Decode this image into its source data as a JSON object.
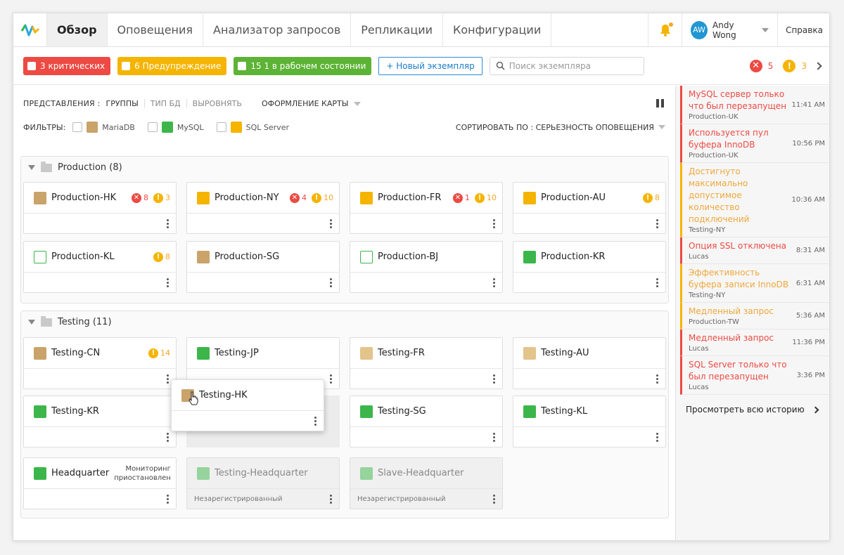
{
  "nav": {
    "tabs": [
      {
        "label": "Обзор",
        "active": true
      },
      {
        "label": "Оповещения"
      },
      {
        "label": "Анализатор запросов"
      },
      {
        "label": "Репликации"
      },
      {
        "label": "Конфигурации"
      }
    ],
    "user": {
      "initials": "AW",
      "name": "Andy Wong"
    },
    "help": "Справка"
  },
  "toolbar": {
    "critical": "3 критических",
    "warning": "6 Предупреждение",
    "healthy": "15 1 в рабочем состоянии",
    "new_instance": "+ Новый экземпляр",
    "search_placeholder": "Поиск экземпляра",
    "err_count": "5",
    "warn_count": "3"
  },
  "view": {
    "label": "ПРЕДСТАВЛЕНИЯ :",
    "groups": "ГРУППЫ",
    "dbtype": "ТИП БД",
    "align": "ВЫРОВНЯТЬ",
    "theme": "ОФОРМЛЕНИЕ КАРТЫ",
    "filters_label": "ФИЛЬТРЫ:",
    "filters": [
      "MariaDB",
      "MySQL",
      "SQL Server"
    ],
    "sort": "СОРТИРОВАТЬ ПО : СЕРЬЕЗНОСТЬ ОПОВЕЩЕНИЯ"
  },
  "groups": [
    {
      "name": "Production (8)",
      "cards": [
        {
          "name": "Production-HK",
          "db": "maria",
          "err": "8",
          "warn": "3"
        },
        {
          "name": "Production-NY",
          "db": "sql",
          "err": "4",
          "warn": "10"
        },
        {
          "name": "Production-FR",
          "db": "sql",
          "err": "1",
          "warn": "10"
        },
        {
          "name": "Production-AU",
          "db": "sql",
          "warn": "8"
        },
        {
          "name": "Production-KL",
          "db": "cloud",
          "warn": "8"
        },
        {
          "name": "Production-SG",
          "db": "maria"
        },
        {
          "name": "Production-BJ",
          "db": "cloud"
        },
        {
          "name": "Production-KR",
          "db": "mysql"
        }
      ]
    },
    {
      "name": "Testing (11)",
      "cards": [
        {
          "name": "Testing-CN",
          "db": "maria",
          "warn": "14"
        },
        {
          "name": "Testing-JP",
          "db": "mysql"
        },
        {
          "name": "Testing-FR",
          "db": "box"
        },
        {
          "name": "Testing-AU",
          "db": "box"
        },
        {
          "name": "Testing-KR",
          "db": "mysql"
        },
        {
          "name": "Testing-HK",
          "db": "maria"
        },
        {
          "name": "Testing-SG",
          "db": "mysql"
        },
        {
          "name": "Testing-KL",
          "db": "mysql"
        },
        {
          "name": "Headquarter",
          "db": "mysql",
          "status": "Мониторинг приостановлен"
        },
        {
          "name": "Testing-Headquarter",
          "db": "mysql",
          "footer": "Незарегистрированный"
        },
        {
          "name": "Slave-Headquarter",
          "db": "mysql",
          "footer": "Незарегистрированный"
        }
      ]
    }
  ],
  "events": [
    {
      "title": "MySQL сервер только что был перезапущен",
      "source": "Production-UK",
      "time": "11:41 AM",
      "level": "critical"
    },
    {
      "title": "Используется пул буфера InnoDB",
      "source": "Production-UK",
      "time": "10:56 PM",
      "level": "critical"
    },
    {
      "title": "Достигнуто максимально допустимое количество подключений",
      "source": "Testing-NY",
      "time": "10:36 AM",
      "level": "warning"
    },
    {
      "title": "Опция SSL отключена",
      "source": "Lucas",
      "time": "8:31 AM",
      "level": "critical"
    },
    {
      "title": "Эффективность буфера записи InnoDB",
      "source": "Testing-NY",
      "time": "6:31 AM",
      "level": "warning"
    },
    {
      "title": "Медленный запрос",
      "source": "Production-TW",
      "time": "5:36 AM",
      "level": "warning"
    },
    {
      "title": "Медленный запрос",
      "source": "Lucas",
      "time": "11:36 PM",
      "level": "critical"
    },
    {
      "title": "SQL Server только что был перезапущен",
      "source": "Lucas",
      "time": "3:36 PM",
      "level": "critical"
    }
  ],
  "history": "Просмотреть всю историю",
  "colors": {
    "critical": "#ec4a43",
    "warning": "#f5b400",
    "healthy": "#5cb335",
    "accent": "#2b8bd6"
  }
}
